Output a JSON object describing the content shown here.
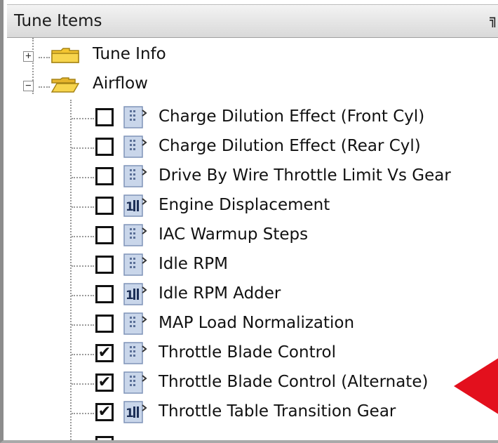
{
  "panel": {
    "title": "Tune Items",
    "pin_glyph": "╗"
  },
  "tree": {
    "nodes": [
      {
        "label": "Tune Info",
        "expanded": false,
        "expander": "+"
      },
      {
        "label": "Airflow",
        "expanded": true,
        "expander": "−"
      }
    ],
    "items": [
      {
        "label": "Charge Dilution Effect (Front Cyl)",
        "checked": false,
        "icon": "table-icon"
      },
      {
        "label": "Charge Dilution Effect (Rear Cyl)",
        "checked": false,
        "icon": "table-icon"
      },
      {
        "label": "Drive By Wire Throttle Limit Vs Gear",
        "checked": false,
        "icon": "table-icon"
      },
      {
        "label": "Engine Displacement",
        "checked": false,
        "icon": "scalar-icon"
      },
      {
        "label": "IAC Warmup Steps",
        "checked": false,
        "icon": "table-icon"
      },
      {
        "label": "Idle RPM",
        "checked": false,
        "icon": "table-icon"
      },
      {
        "label": "Idle RPM Adder",
        "checked": false,
        "icon": "scalar-icon"
      },
      {
        "label": "MAP Load Normalization",
        "checked": false,
        "icon": "table-icon"
      },
      {
        "label": "Throttle Blade Control",
        "checked": true,
        "icon": "table-icon"
      },
      {
        "label": "Throttle Blade Control (Alternate)",
        "checked": true,
        "icon": "table-icon"
      },
      {
        "label": "Throttle Table Transition Gear",
        "checked": true,
        "icon": "scalar-icon"
      }
    ]
  },
  "colors": {
    "arrow": "#e3101d",
    "folder_yellow": "#f3c530"
  }
}
